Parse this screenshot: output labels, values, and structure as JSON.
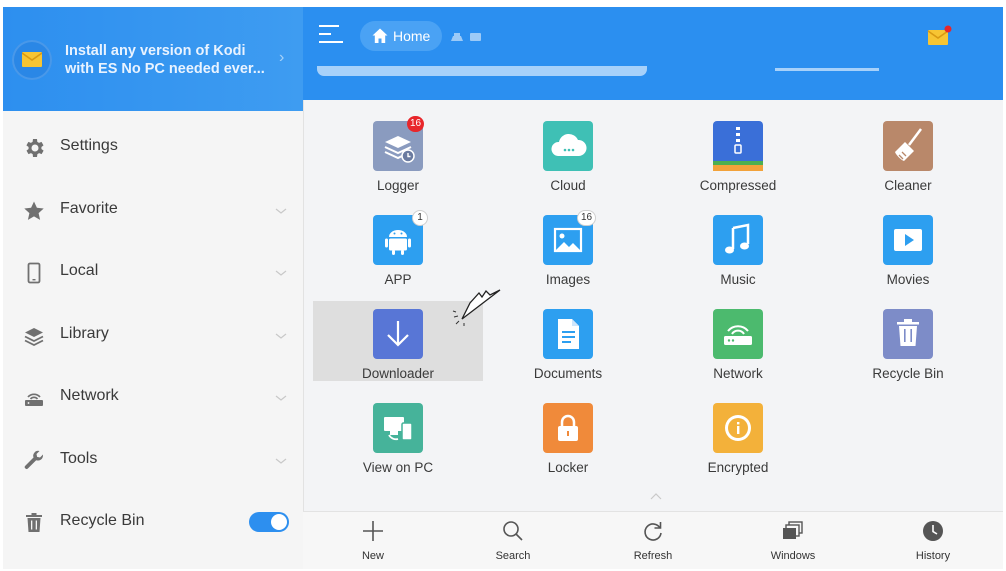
{
  "promo": {
    "text": "Install any version of Kodi with ES No PC needed ever...",
    "icon": "mail-icon"
  },
  "sidebar": {
    "items": [
      {
        "label": "Settings",
        "icon": "gear-icon"
      },
      {
        "label": "Favorite",
        "icon": "star-icon"
      },
      {
        "label": "Local",
        "icon": "phone-icon"
      },
      {
        "label": "Library",
        "icon": "layers-icon"
      },
      {
        "label": "Network",
        "icon": "router-icon"
      },
      {
        "label": "Tools",
        "icon": "wrench-icon"
      },
      {
        "label": "Recycle Bin",
        "icon": "trash-icon",
        "toggle_on": true
      }
    ]
  },
  "header": {
    "home_label": "Home"
  },
  "tiles": [
    {
      "label": "Logger",
      "badge": "16",
      "color": "#8a9bbf"
    },
    {
      "label": "Cloud",
      "color": "#3fc0b5"
    },
    {
      "label": "Compressed",
      "color": "#3a6fd8"
    },
    {
      "label": "Cleaner",
      "color": "#b9886a"
    },
    {
      "label": "APP",
      "badge": "1",
      "color": "#2d9ff0"
    },
    {
      "label": "Images",
      "badge": "16",
      "color": "#2d9ff0"
    },
    {
      "label": "Music",
      "color": "#2d9ff0"
    },
    {
      "label": "Movies",
      "color": "#2d9ff0"
    },
    {
      "label": "Downloader",
      "color": "#5876d6"
    },
    {
      "label": "Documents",
      "color": "#2d9ff0"
    },
    {
      "label": "Network",
      "color": "#4cba6e"
    },
    {
      "label": "Recycle Bin",
      "color": "#7d8cc8"
    },
    {
      "label": "View on PC",
      "color": "#46b39a"
    },
    {
      "label": "Locker",
      "color": "#f08a3a"
    },
    {
      "label": "Encrypted",
      "color": "#f3b13a"
    }
  ],
  "toolbar": {
    "new_label": "New",
    "search_label": "Search",
    "refresh_label": "Refresh",
    "windows_label": "Windows",
    "history_label": "History"
  },
  "colors": {
    "accent": "#2b8ff0",
    "badge_red": "#e8262b"
  }
}
